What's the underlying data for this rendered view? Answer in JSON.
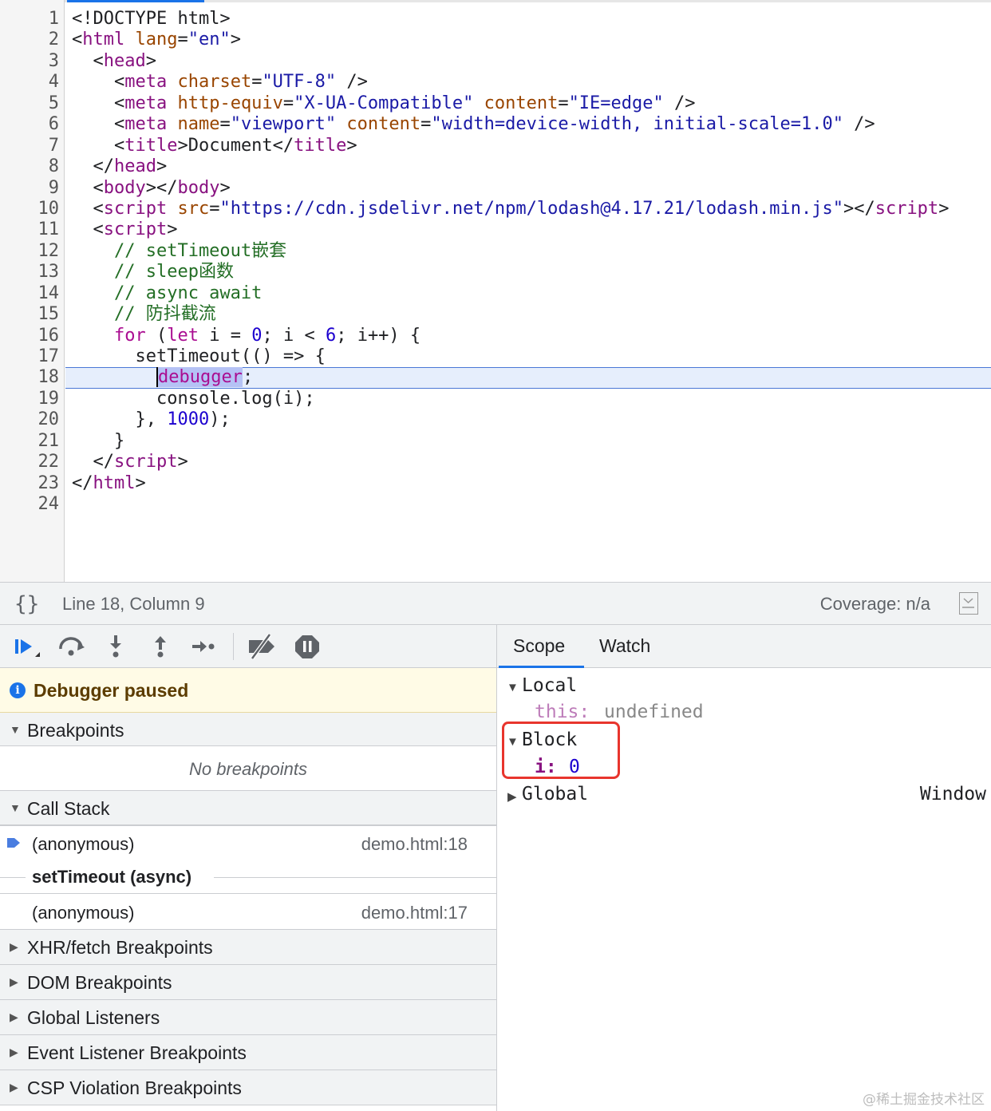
{
  "editor": {
    "line_numbers": [
      "1",
      "2",
      "3",
      "4",
      "5",
      "6",
      "7",
      "8",
      "9",
      "10",
      "11",
      "12",
      "13",
      "14",
      "15",
      "16",
      "17",
      "18",
      "19",
      "20",
      "21",
      "22",
      "23",
      "24"
    ],
    "paused_line": "18"
  },
  "status_bar": {
    "pretty_print": "{}",
    "cursor_position": "Line 18, Column 9",
    "coverage": "Coverage: n/a"
  },
  "debugger": {
    "paused_text": "Debugger paused",
    "sections": {
      "breakpoints": "Breakpoints",
      "no_breakpoints": "No breakpoints",
      "call_stack": "Call Stack",
      "xhr": "XHR/fetch Breakpoints",
      "dom": "DOM Breakpoints",
      "global_listeners": "Global Listeners",
      "event_listener": "Event Listener Breakpoints",
      "csp": "CSP Violation Breakpoints"
    },
    "call_stack": [
      {
        "fn": "(anonymous)",
        "loc": "demo.html:18"
      },
      {
        "fn": "(anonymous)",
        "loc": "demo.html:17"
      }
    ],
    "async_label": "setTimeout (async)"
  },
  "scope_panel": {
    "tabs": [
      "Scope",
      "Watch"
    ],
    "local_label": "Local",
    "this_key": "this:",
    "this_value": "undefined",
    "block_label": "Block",
    "block_var_key": "i:",
    "block_var_value": "0",
    "global_label": "Global",
    "global_value": "Window"
  },
  "watermark": "@稀土掘金技术社区"
}
